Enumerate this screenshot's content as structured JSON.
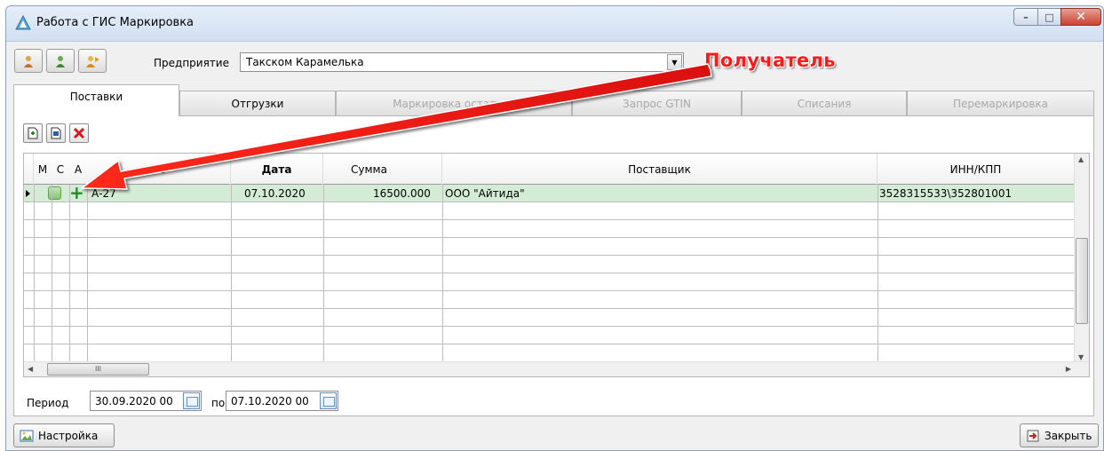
{
  "window": {
    "title": "Работа с ГИС Маркировка",
    "controls": {
      "minimize": "–",
      "maximize": "□",
      "close": "✕"
    }
  },
  "toolbar": {
    "enterprise_label": "Предприятие",
    "enterprise_value": "Такском Карамелька",
    "annotation": "Получатель"
  },
  "tabs": [
    {
      "label": "Поставки",
      "state": "active"
    },
    {
      "label": "Отгрузки",
      "state": "normal"
    },
    {
      "label": "Маркировка остатков",
      "state": "disabled"
    },
    {
      "label": "Запрос GTIN",
      "state": "disabled"
    },
    {
      "label": "Списания",
      "state": "disabled"
    },
    {
      "label": "Перемаркировка",
      "state": "disabled"
    }
  ],
  "grid": {
    "headers": {
      "m": "М",
      "c": "С",
      "a": "А",
      "number": "Но",
      "date": "Дата",
      "sum": "Сумма",
      "supplier": "Поставщик",
      "inn": "ИНН/КПП"
    },
    "rows": [
      {
        "number": "А-27",
        "date": "07.10.2020",
        "sum": "16500.000",
        "supplier": "ООО \"Айтида\"",
        "inn": "3528315533\\352801001"
      }
    ]
  },
  "period": {
    "label": "Период",
    "from": "30.09.2020 00",
    "to_label": "по",
    "to": "07.10.2020 00"
  },
  "footer": {
    "settings_label": "Настройка",
    "close_label": "Закрыть"
  },
  "colors": {
    "selected_row": "#d4ecd5",
    "annotation": "#ff1a1a"
  }
}
